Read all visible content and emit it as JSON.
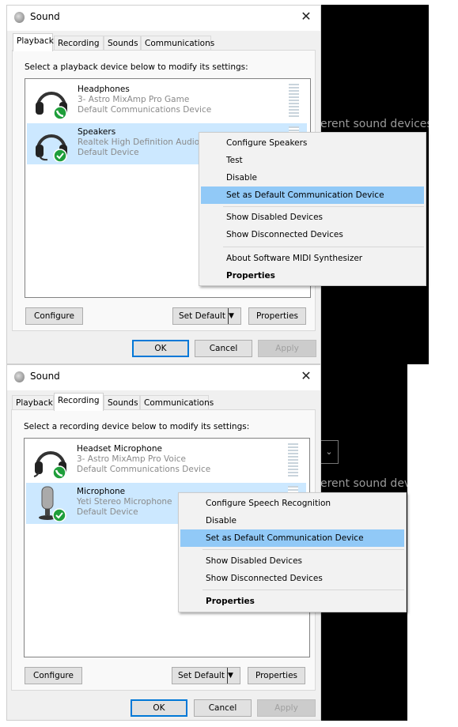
{
  "background": {
    "text_top": "erent sound devices t",
    "text_bottom": "erent sound devic",
    "dropdown_icon": "chevron-down-icon"
  },
  "dialogs": [
    {
      "title": "Sound",
      "close_icon": "close-icon",
      "tabs": [
        {
          "label": "Playback"
        },
        {
          "label": "Recording"
        },
        {
          "label": "Sounds"
        },
        {
          "label": "Communications"
        }
      ],
      "selected_tab": "Playback",
      "instruction": "Select a playback device below to modify its settings:",
      "devices": [
        {
          "name": "Headphones",
          "line1": "3- Astro MixAmp Pro Game",
          "line2": "Default Communications Device",
          "icon": "headphones-icon",
          "badge": "phone-badge-icon",
          "selected": false
        },
        {
          "name": "Speakers",
          "line1": "Realtek High Definition Audio",
          "line2": "Default Device",
          "icon": "headset-icon",
          "badge": "check-badge-icon",
          "selected": true
        }
      ],
      "context_menu": [
        "Configure Speakers",
        "Test",
        "Disable",
        "Set as Default Communication Device",
        "Show Disabled Devices",
        "Show Disconnected Devices",
        "About Software MIDI Synthesizer",
        "Properties"
      ],
      "highlighted": "Set as Default Communication Device",
      "buttons": {
        "configure": "Configure",
        "set_default": "Set Default",
        "properties": "Properties",
        "ok": "OK",
        "cancel": "Cancel",
        "apply": "Apply"
      }
    },
    {
      "title": "Sound",
      "close_icon": "close-icon",
      "tabs": [
        {
          "label": "Playback"
        },
        {
          "label": "Recording"
        },
        {
          "label": "Sounds"
        },
        {
          "label": "Communications"
        }
      ],
      "selected_tab": "Recording",
      "instruction": "Select a recording device below to modify its settings:",
      "devices": [
        {
          "name": "Headset Microphone",
          "line1": "3- Astro MixAmp Pro Voice",
          "line2": "Default Communications Device",
          "icon": "headset-icon",
          "badge": "phone-badge-icon",
          "selected": false
        },
        {
          "name": "Microphone",
          "line1": "Yeti Stereo Microphone",
          "line2": "Default Device",
          "icon": "microphone-icon",
          "badge": "check-badge-icon",
          "selected": true
        }
      ],
      "context_menu": [
        "Configure Speech Recognition",
        "Disable",
        "Set as Default Communication Device",
        "Show Disabled Devices",
        "Show Disconnected Devices",
        "Properties"
      ],
      "highlighted": "Set as Default Communication Device",
      "buttons": {
        "configure": "Configure",
        "set_default": "Set Default",
        "properties": "Properties",
        "ok": "OK",
        "cancel": "Cancel",
        "apply": "Apply"
      }
    }
  ]
}
